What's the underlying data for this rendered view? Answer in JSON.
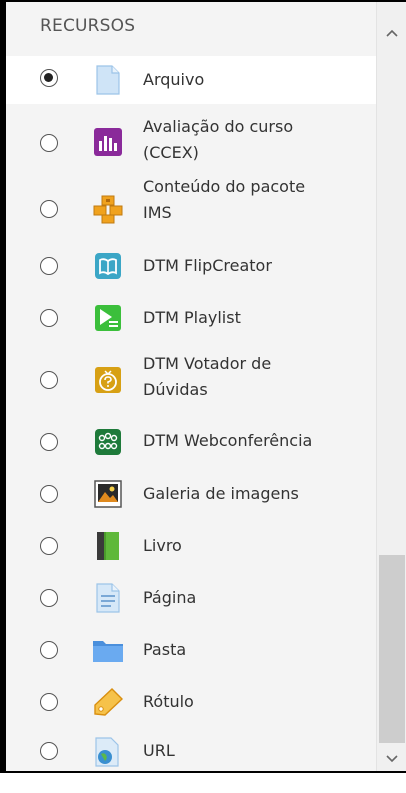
{
  "section": {
    "title": "RECURSOS"
  },
  "items": [
    {
      "label": "Arquivo",
      "icon": "file-icon",
      "selected": true
    },
    {
      "label": "Avaliação do curso\n(CCEX)",
      "icon": "survey-chart-icon",
      "selected": false
    },
    {
      "label": "Conteúdo do pacote\nIMS",
      "icon": "ims-package-icon",
      "selected": false
    },
    {
      "label": "DTM FlipCreator",
      "icon": "flipbook-icon",
      "selected": false
    },
    {
      "label": "DTM Playlist",
      "icon": "playlist-icon",
      "selected": false
    },
    {
      "label": "DTM Votador de\nDúvidas",
      "icon": "question-voter-icon",
      "selected": false
    },
    {
      "label": "DTM Webconferência",
      "icon": "webconference-icon",
      "selected": false
    },
    {
      "label": "Galeria de imagens",
      "icon": "image-gallery-icon",
      "selected": false
    },
    {
      "label": "Livro",
      "icon": "book-icon",
      "selected": false
    },
    {
      "label": "Página",
      "icon": "page-icon",
      "selected": false
    },
    {
      "label": "Pasta",
      "icon": "folder-icon",
      "selected": false
    },
    {
      "label": "Rótulo",
      "icon": "label-tag-icon",
      "selected": false
    },
    {
      "label": "URL",
      "icon": "url-globe-icon",
      "selected": false
    }
  ],
  "colors": {
    "panel_bg": "#f4f4f4",
    "selected_bg": "#ffffff",
    "survey": "#8a2a9a",
    "ims": "#f0a21e",
    "flip": "#3ba6c6",
    "playlist": "#3bbf3b",
    "voter": "#d7a014",
    "webconf": "#1e7a3a"
  }
}
